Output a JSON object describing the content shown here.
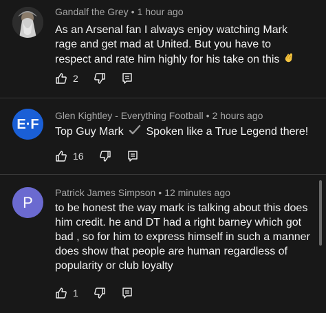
{
  "comments": [
    {
      "author": "Gandalf the Grey",
      "time": "1 hour ago",
      "text": "As an Arsenal fan I always enjoy watching Mark rage and get mad at United. But you have to respect and rate him highly for his take on this",
      "emoji": "clapping-hands",
      "likes": "2"
    },
    {
      "author": "Glen Kightley - Everything Football",
      "time": "2 hours ago",
      "text_before": "Top Guy Mark",
      "text_after": "Spoken like a True Legend there!",
      "avatar_text": "E F",
      "likes": "16"
    },
    {
      "author": "Patrick James Simpson",
      "time": "12 minutes ago",
      "avatar_letter": "P",
      "text": "to be honest the way mark is talking about this does him credit. he and DT had a right barney which got bad , so for him to express himself in such a manner does show that people are human regardless of popularity or club loyalty",
      "likes": "1"
    }
  ],
  "colors": {
    "background": "#181818",
    "avatar_blue": "#1a5fd6",
    "avatar_purple": "#6b6ad0"
  }
}
